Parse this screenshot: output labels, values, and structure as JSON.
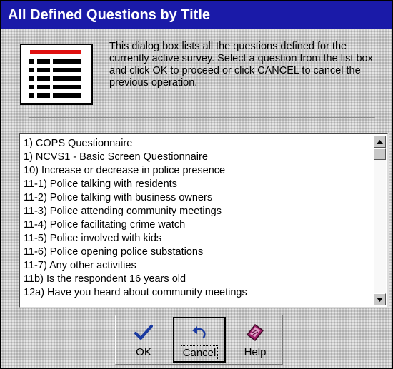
{
  "window": {
    "title": "All Defined Questions by Title"
  },
  "description": "This dialog box lists all the questions defined for the currently active survey. Select a question from the list box and click OK to proceed or click CANCEL to cancel the previous operation.",
  "icons": {
    "header": "list-document-icon",
    "ok": "checkmark-icon",
    "cancel": "undo-arrow-icon",
    "help": "help-book-icon"
  },
  "questions": [
    "1) COPS Questionnaire",
    "1) NCVS1 - Basic Screen Questionnaire",
    "10) Increase or decrease in police presence",
    "11-1) Police talking with residents",
    "11-2) Police talking with business owners",
    "11-3) Police attending community meetings",
    "11-4) Police facilitating crime watch",
    "11-5) Police involved with kids",
    "11-6) Police opening police substations",
    "11-7) Any other activities",
    "11b) Is the respondent 16 years old",
    "12a) Have you heard about community meetings"
  ],
  "buttons": {
    "ok": "OK",
    "cancel": "Cancel",
    "help": "Help"
  },
  "colors": {
    "titlebar": "#1a1aa8",
    "accent_red": "#e01010",
    "ok_check": "#1a3aa0",
    "help_book": "#a0206a"
  }
}
